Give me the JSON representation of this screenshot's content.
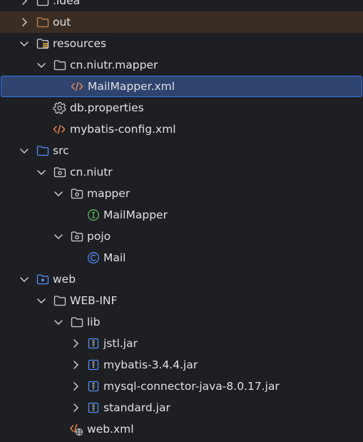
{
  "project_tree": {
    "items": [
      {
        "label": ".idea",
        "type": "folder"
      },
      {
        "label": "out",
        "type": "excluded-folder"
      },
      {
        "label": "resources",
        "type": "resources-root"
      },
      {
        "label": "cn.niutr.mapper",
        "type": "folder"
      },
      {
        "label": "MailMapper.xml",
        "type": "xml-file",
        "selected": true
      },
      {
        "label": "db.properties",
        "type": "properties-file"
      },
      {
        "label": "mybatis-config.xml",
        "type": "xml-file"
      },
      {
        "label": "src",
        "type": "source-root"
      },
      {
        "label": "cn.niutr",
        "type": "package"
      },
      {
        "label": "mapper",
        "type": "package"
      },
      {
        "label": "MailMapper",
        "type": "interface"
      },
      {
        "label": "pojo",
        "type": "package"
      },
      {
        "label": "Mail",
        "type": "class"
      },
      {
        "label": "web",
        "type": "web-module"
      },
      {
        "label": "WEB-INF",
        "type": "folder"
      },
      {
        "label": "lib",
        "type": "folder"
      },
      {
        "label": "jstl.jar",
        "type": "jar"
      },
      {
        "label": "mybatis-3.4.4.jar",
        "type": "jar"
      },
      {
        "label": "mysql-connector-java-8.0.17.jar",
        "type": "jar"
      },
      {
        "label": "standard.jar",
        "type": "jar"
      },
      {
        "label": "web.xml",
        "type": "web-xml"
      }
    ]
  },
  "colors": {
    "background": "#1e1f22",
    "text": "#dfe1e5",
    "selection": "#2e436e",
    "selection_border": "#3574f0",
    "excluded_row": "#3a2e24",
    "excluded_folder_icon": "#c9824e",
    "source_folder_icon": "#548af7",
    "xml_icon": "#e8834e",
    "interface_icon": "#5fb865",
    "class_icon": "#548af7"
  }
}
